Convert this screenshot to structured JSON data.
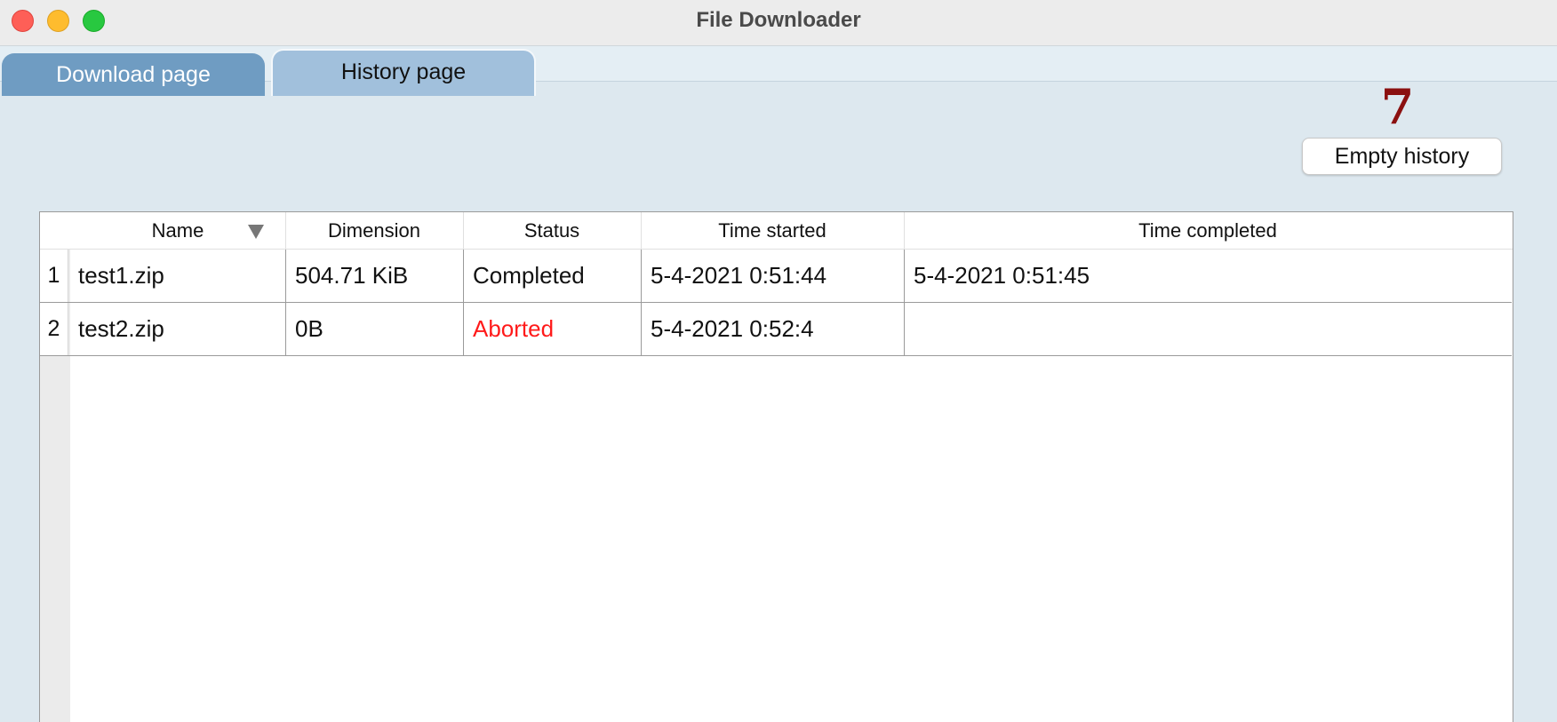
{
  "window": {
    "title": "File Downloader"
  },
  "tabs": [
    {
      "label": "Download page",
      "active": false
    },
    {
      "label": "History page",
      "active": true
    }
  ],
  "history": {
    "badge_count": "7",
    "empty_button_label": "Empty history"
  },
  "table": {
    "columns": [
      "Name",
      "Dimension",
      "Status",
      "Time started",
      "Time completed"
    ],
    "sort_column": "Name",
    "rows": [
      {
        "index": "1",
        "name": "test1.zip",
        "dimension": "504.71 KiB",
        "status": "Completed",
        "time_started": "5-4-2021 0:51:44",
        "time_completed": "5-4-2021 0:51:45"
      },
      {
        "index": "2",
        "name": "test2.zip",
        "dimension": "0B",
        "status": "Aborted",
        "time_started": "5-4-2021 0:52:4",
        "time_completed": ""
      }
    ]
  },
  "colors": {
    "aborted": "#ff1a1a",
    "badge": "#8b1010",
    "tab_active": "#a1c0dc",
    "tab_inactive": "#6f9cc2"
  }
}
